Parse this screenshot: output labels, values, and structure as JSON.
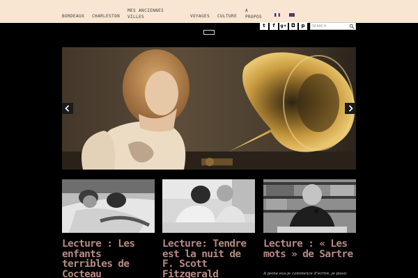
{
  "nav": {
    "items": [
      {
        "line1": "BORDEAUX",
        "line2": ""
      },
      {
        "line1": "CHARLESTON",
        "line2": ""
      },
      {
        "line1": "MES ANCIENNES",
        "line2": "VILLES"
      },
      {
        "line1": "VOYAGES",
        "line2": ""
      },
      {
        "line1": "CULTURE",
        "line2": ""
      },
      {
        "line1": "A",
        "line2": "PROPOS"
      }
    ],
    "languages": [
      "fr",
      "en"
    ]
  },
  "social": [
    {
      "icon": "twitter-icon",
      "glyph": "t"
    },
    {
      "icon": "facebook-icon",
      "glyph": "f"
    },
    {
      "icon": "google-plus-icon",
      "glyph": "g+"
    },
    {
      "icon": "instagram-icon",
      "glyph": "◘"
    },
    {
      "icon": "pinterest-icon",
      "glyph": "p"
    }
  ],
  "search": {
    "placeholder": "SEARCH"
  },
  "posts": [
    {
      "title": "Lecture : Les enfants terribles de Cocteau",
      "excerpt": ""
    },
    {
      "title": "Lecture: Tendre est la nuit de F. Scott Fitzgerald",
      "excerpt": ""
    },
    {
      "title": "Lecture : « Les mots » de Sartre",
      "excerpt": "A peine eus-je commencé d'écrire, je posai"
    }
  ],
  "colors": {
    "nav_background": "#f8e6d3",
    "page_background": "#000000",
    "post_title": "#b58a84"
  }
}
